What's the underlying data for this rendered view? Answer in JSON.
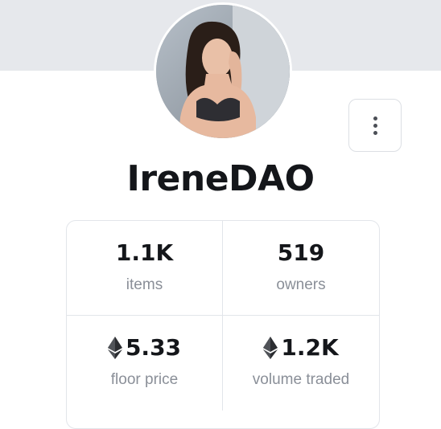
{
  "profile": {
    "name": "IreneDAO"
  },
  "stats": [
    {
      "value": "1.1K",
      "label": "items",
      "eth": false
    },
    {
      "value": "519",
      "label": "owners",
      "eth": false
    },
    {
      "value": "5.33",
      "label": "floor price",
      "eth": true
    },
    {
      "value": "1.2K",
      "label": "volume traded",
      "eth": true
    }
  ],
  "icons": {
    "currency": "ethereum-icon",
    "menu": "more-vertical-icon"
  },
  "colors": {
    "banner": "#e6e8ec",
    "text": "#14161a",
    "muted": "#8a8f98",
    "border": "#e2e5ea"
  }
}
